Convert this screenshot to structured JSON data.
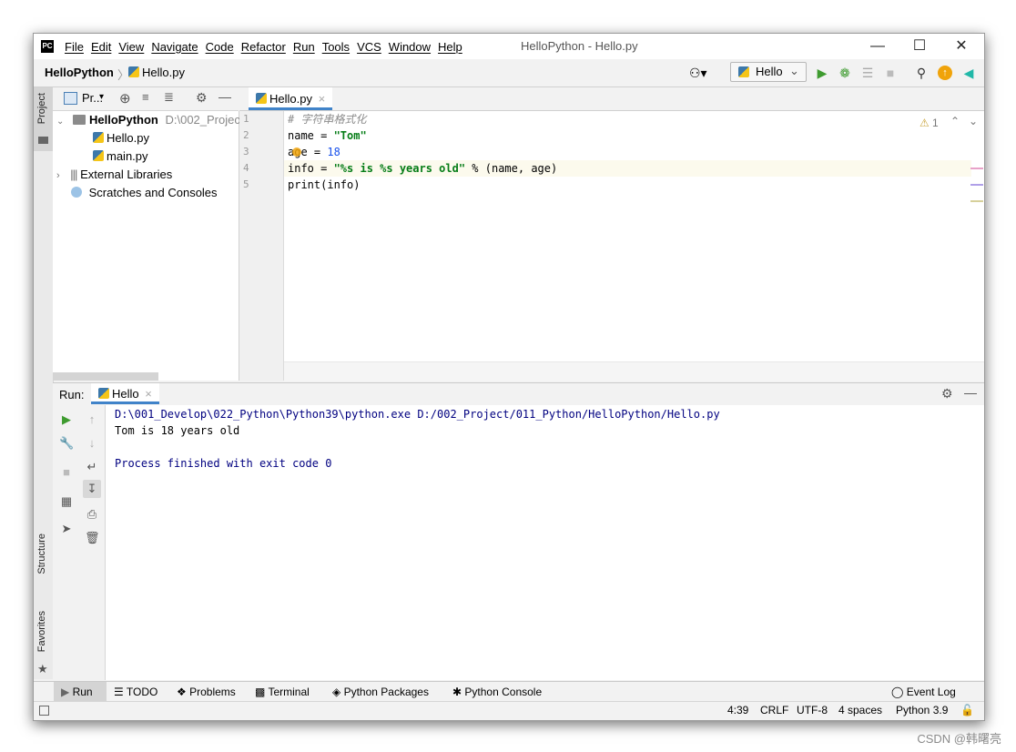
{
  "titlebar": {
    "logo": "PC",
    "menu": [
      "File",
      "Edit",
      "View",
      "Navigate",
      "Code",
      "Refactor",
      "Run",
      "Tools",
      "VCS",
      "Window",
      "Help"
    ],
    "title": "HelloPython - Hello.py"
  },
  "navbar": {
    "project": "HelloPython",
    "file": "Hello.py",
    "run_config": "Hello"
  },
  "left_stripe": {
    "project": "Project",
    "structure": "Structure",
    "favorites": "Favorites"
  },
  "project_panel": {
    "header": "Pr...",
    "root_name": "HelloPython",
    "root_path": "D:\\002_Projec",
    "files": [
      "Hello.py",
      "main.py"
    ],
    "external": "External Libraries",
    "scratches": "Scratches and Consoles"
  },
  "editor": {
    "tab": "Hello.py",
    "warning_count": "1",
    "line_numbers": [
      "1",
      "2",
      "3",
      "4",
      "5"
    ],
    "lines": {
      "l1": "# 字符串格式化",
      "l2a": "name = ",
      "l2b": "\"Tom\"",
      "l3a": "age = ",
      "l3b": "18",
      "l4a": "info = ",
      "l4b": "\"%s is %s years old\"",
      "l4c": " % (name, age)",
      "l5": "print(info)"
    }
  },
  "run_panel": {
    "label": "Run:",
    "tab": "Hello",
    "console": [
      "D:\\001_Develop\\022_Python\\Python39\\python.exe D:/002_Project/011_Python/HelloPython/Hello.py",
      "Tom is 18 years old",
      "",
      "Process finished with exit code 0"
    ]
  },
  "tool_tabs": {
    "run": "Run",
    "todo": "TODO",
    "problems": "Problems",
    "terminal": "Terminal",
    "packages": "Python Packages",
    "console": "Python Console",
    "event_log": "Event Log"
  },
  "status": {
    "position": "4:39",
    "line_sep": "CRLF",
    "encoding": "UTF-8",
    "indent": "4 spaces",
    "interpreter": "Python 3.9"
  },
  "watermark": "CSDN @韩曙亮",
  "colors": {
    "accent": "#4083c9",
    "console_text": "#000080",
    "string": "#067d17",
    "number": "#1750eb",
    "run_green": "#3e9b2f"
  }
}
